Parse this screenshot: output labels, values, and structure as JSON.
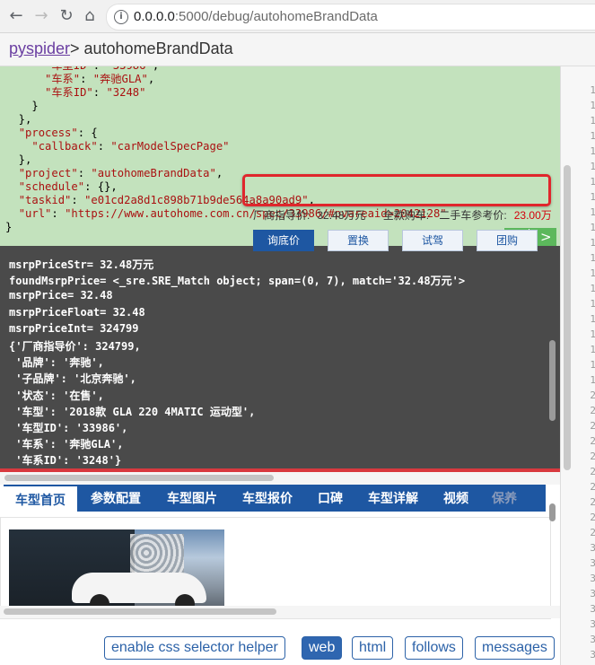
{
  "browser": {
    "url_host": "0.0.0.0",
    "url_rest": ":5000/debug/autohomeBrandData",
    "back_glyph": "←",
    "forward_glyph": "→",
    "reload_glyph": "↻",
    "home_glyph": "⌂",
    "info_glyph": "i"
  },
  "header": {
    "brand": "pyspider",
    "crumb": "> autohomeBrandData"
  },
  "task_json_lines": [
    "      \"车型ID\": \"33986\",",
    "      \"车系\": \"奔驰GLA\",",
    "      \"车系ID\": \"3248\"",
    "    }",
    "  },",
    "  \"process\": {",
    "    \"callback\": \"carModelSpecPage\"",
    "  },",
    "  \"project\": \"autohomeBrandData\",",
    "  \"schedule\": {},",
    "  \"taskid\": \"e01cd2a8d1c898b71b9de564a8a90ad9\",",
    "  \"url\": \"https://www.autohome.com.cn/spec/33986/#pvareaid=2042128\"",
    "}"
  ],
  "pager": {
    "prev": "<",
    "next": ">"
  },
  "console_lines": [
    "msrpPriceStr= 32.48万元",
    "foundMsrpPrice= <_sre.SRE_Match object; span=(0, 7), match='32.48万元'>",
    "msrpPrice= 32.48",
    "msrpPriceFloat= 32.48",
    "msrpPriceInt= 324799",
    "{'厂商指导价': 324799,",
    " '品牌': '奔驰',",
    " '子品牌': '北京奔驰',",
    " '状态': '在售',",
    " '车型': '2018款 GLA 220 4MATIC 运动型',",
    " '车型ID': '33986',",
    " '车系': '奔驰GLA',",
    " '车系ID': '3248'}"
  ],
  "preview": {
    "tabs": [
      "车型首页",
      "参数配置",
      "车型图片",
      "车型报价",
      "口碑",
      "车型详解",
      "视频",
      "保养"
    ],
    "msrp_label": "厂商指导价:",
    "msrp_value": "32.48万元",
    "full_price_label": "全款购车:",
    "used_label": "二手车参考价:",
    "used_value": "23.00万",
    "buttons": [
      "询底价",
      "置换",
      "试驾",
      "团购"
    ]
  },
  "bottom_bar": {
    "css_helper": "enable css selector helper",
    "web": "web",
    "html": "html",
    "follows": "follows",
    "messages": "messages"
  },
  "gutter_numbers": [
    "1",
    "1",
    "1",
    "1",
    "1",
    "1",
    "1",
    "1",
    "1",
    "1",
    "1",
    "1",
    "1",
    "1",
    "1",
    "1",
    "1",
    "1",
    "1",
    "1",
    "2",
    "2",
    "2",
    "2",
    "2",
    "2",
    "2",
    "2",
    "2",
    "2",
    "3",
    "3",
    "3",
    "3",
    "3",
    "3",
    "3",
    "3"
  ],
  "colors": {
    "task_bg": "#c3e2bd",
    "console_bg": "#4a4a4a",
    "console_border": "#d8393f",
    "autohome_blue": "#1e57a2",
    "highlight_red": "#e0262c"
  }
}
